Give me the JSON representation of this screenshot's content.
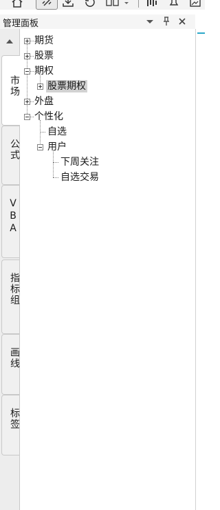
{
  "toolbar": {
    "buttons": [
      {
        "name": "home-icon"
      },
      {
        "name": "link-icon",
        "active": true
      },
      {
        "name": "download-icon"
      },
      {
        "name": "refresh-icon"
      },
      {
        "name": "layout-icon"
      },
      {
        "name": "chevron-down-icon"
      },
      {
        "name": "chart-icon"
      },
      {
        "name": "bell-icon"
      },
      {
        "name": "picture-icon"
      }
    ]
  },
  "panel": {
    "title": "管理面板",
    "dropdown_icon": "chevron-down-icon",
    "pin_icon": "pin-icon",
    "close_icon": "close-icon"
  },
  "side_tabs": [
    {
      "label": "市场",
      "active": true
    },
    {
      "label": "公式",
      "active": false
    },
    {
      "label": "VBA",
      "active": false
    },
    {
      "label": "指标组",
      "active": false
    },
    {
      "label": "画线",
      "active": false
    },
    {
      "label": "标签",
      "active": false
    }
  ],
  "tree": {
    "items": [
      {
        "label": "期货",
        "expanded": false
      },
      {
        "label": "股票",
        "expanded": false
      },
      {
        "label": "期权",
        "expanded": true
      },
      {
        "label": "股票期权",
        "expanded": false,
        "selected": true
      },
      {
        "label": "外盘",
        "expanded": false
      },
      {
        "label": "个性化",
        "expanded": true
      },
      {
        "label": "自选"
      },
      {
        "label": "用户",
        "expanded": true
      },
      {
        "label": "下周关注"
      },
      {
        "label": "自选交易"
      }
    ]
  }
}
